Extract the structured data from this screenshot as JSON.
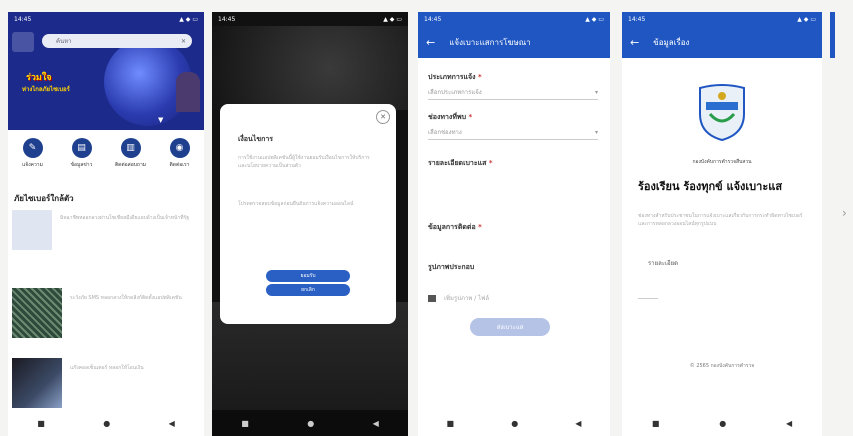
{
  "screen1": {
    "status_time": "14:45",
    "search_placeholder": "ค้นหา",
    "banner_title": "ร่วมใจ",
    "banner_subtitle": "ห่างไกลภัยไซเบอร์",
    "quick_actions": [
      {
        "label": "แจ้งความ",
        "icon": "pen-icon"
      },
      {
        "label": "ข้อมูลข่าว",
        "icon": "document-icon"
      },
      {
        "label": "ติดต่อสอบถาม",
        "icon": "book-icon"
      },
      {
        "label": "ติดต่อเรา",
        "icon": "location-pin-icon"
      }
    ],
    "section_title": "ภัยไซเบอร์ใกล้ตัว",
    "news": [
      {
        "text": "มิจฉาชีพหลอกลวงผ่านโซเชียลมีเดียแอบอ้างเป็นเจ้าหน้าที่รัฐ"
      },
      {
        "text": "ระวังภัย SMS หลอกลวงให้กดลิงก์ติดตั้งแอปพลิเคชัน"
      },
      {
        "text": "แก๊งคอลเซ็นเตอร์ หลอกให้โอนเงิน"
      }
    ]
  },
  "screen2": {
    "status_time": "14:45",
    "dialog_title": "เงื่อนไขการ",
    "dialog_text_1": "การใช้งานแอปพลิเคชันนี้ผู้ใช้งานยอมรับเงื่อนไขการให้บริการและนโยบายความเป็นส่วนตัว",
    "dialog_text_2": "โปรดตรวจสอบข้อมูลก่อนยืนยันการแจ้งความออนไลน์",
    "accept_label": "ยอมรับ",
    "cancel_label": "ยกเลิก"
  },
  "screen3": {
    "status_time": "14:45",
    "title": "แจ้งเบาะแสการโฆษณา",
    "fields": [
      {
        "label": "ประเภทการแจ้ง",
        "value": "เลือกประเภทการแจ้ง"
      },
      {
        "label": "ช่องทางที่พบ",
        "value": "เลือกช่องทาง"
      }
    ],
    "detail_label": "รายละเอียดเบาะแส",
    "contact_label": "ข้อมูลการติดต่อ",
    "attach_label": "รูปภาพประกอบ",
    "attach_button": "เพิ่มรูปภาพ / ไฟล์",
    "submit_label": "ส่งเบาะแส"
  },
  "screen4": {
    "status_time": "14:45",
    "title": "ข้อมูลเรื่อง",
    "org_name": "กองบังคับการตำรวจสืบสวน",
    "heading": "ร้องเรียน ร้องทุกข์ แจ้งเบาะแส",
    "body": "ช่องทางสำหรับประชาชนในการแจ้งเบาะแสเกี่ยวกับการกระทำผิดทางไซเบอร์และการหลอกลวงออนไลน์ทุกรูปแบบ",
    "detail_label": "รายละเอียด",
    "footer": "© 2565 กองบังคับการตำรวจ"
  },
  "colors": {
    "primary": "#1f56c2",
    "banner_bg": "#1c2a8c",
    "dialog_button": "#2a5fc4",
    "disabled_button": "#b5c3e6"
  }
}
